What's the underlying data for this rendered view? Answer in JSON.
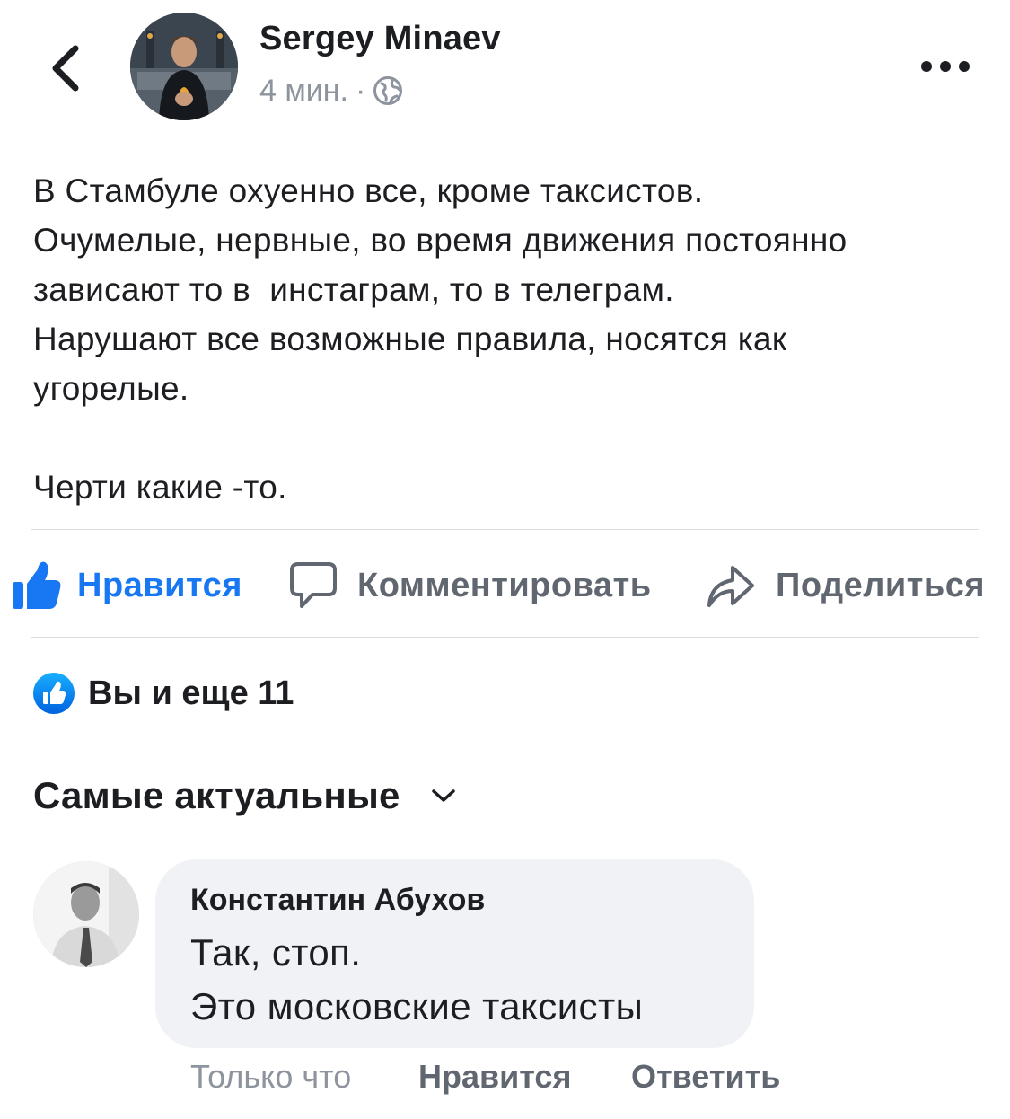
{
  "post": {
    "author": "Sergey Minaev",
    "time": "4 мин.",
    "separator": "·",
    "audience_icon": "globe-icon",
    "text_lines": [
      "В Стамбуле охуенно все, кроме таксистов.",
      "Очумелые, нервные, во время движения постоянно",
      "зависают то в  инстаграм, то в телеграм.",
      "Нарушают все возможные правила, носятся как",
      "угорелые."
    ],
    "text_lines_2": [
      "Черти какие -то."
    ]
  },
  "actions": {
    "like": "Нравится",
    "comment": "Комментировать",
    "share": "Поделиться"
  },
  "reactions": {
    "summary": "Вы и еще 11"
  },
  "comments_sort": {
    "label": "Самые актуальные"
  },
  "comment": {
    "author": "Константин Абухов",
    "lines": [
      "Так, стоп.",
      "Это московские таксисты"
    ],
    "time": "Только что",
    "like": "Нравится",
    "reply": "Ответить"
  },
  "colors": {
    "accent": "#1877f2",
    "secondary_text": "#606770",
    "muted_text": "#8d949e",
    "bubble": "#f0f2f5"
  }
}
